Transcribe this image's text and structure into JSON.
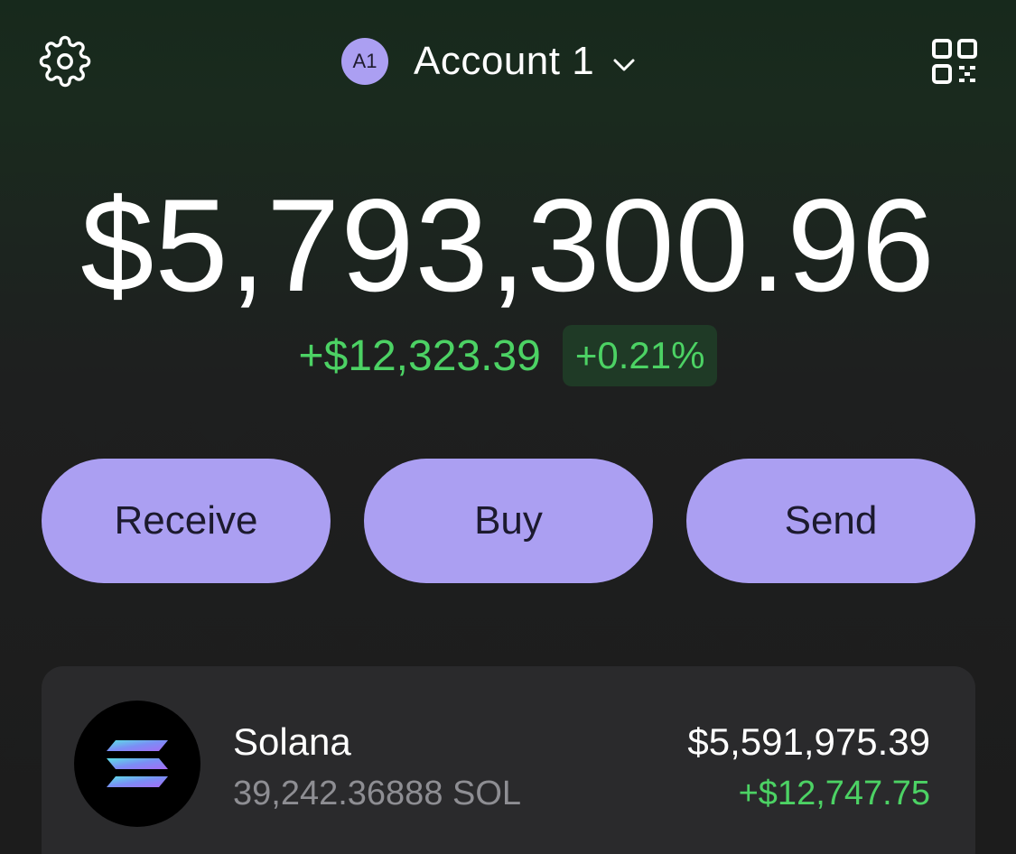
{
  "header": {
    "settings_icon": "gear-icon",
    "account_avatar": "A1",
    "account_name": "Account 1",
    "chevron_icon": "chevron-down-icon",
    "qr_icon": "qr-code-icon"
  },
  "portfolio": {
    "balance": "$5,793,300.96",
    "change_amount": "+$12,323.39",
    "change_percent": "+0.21%"
  },
  "actions": {
    "receive_label": "Receive",
    "buy_label": "Buy",
    "send_label": "Send"
  },
  "tokens": [
    {
      "name": "Solana",
      "amount": "39,242.36888 SOL",
      "value": "$5,591,975.39",
      "change": "+$12,747.75",
      "icon": "solana-logo-icon"
    }
  ],
  "colors": {
    "accent": "#ab9ff2",
    "positive": "#4cd264",
    "background": "#1c1c1c",
    "card": "#2a2a2c"
  }
}
